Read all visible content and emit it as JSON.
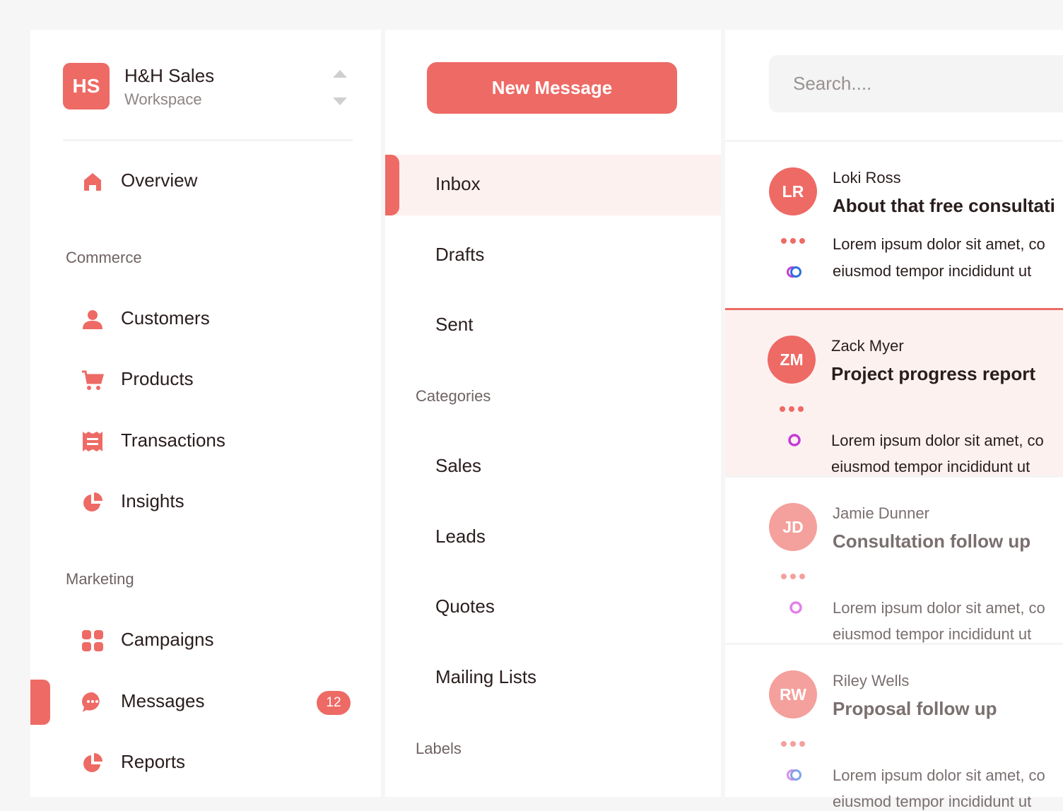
{
  "workspace": {
    "initials": "HS",
    "name": "H&H Sales",
    "subtitle": "Workspace"
  },
  "sidebar": {
    "overview": "Overview",
    "sections": {
      "commerce": "Commerce",
      "marketing": "Marketing"
    },
    "commerce_items": [
      {
        "label": "Customers",
        "icon": "person-icon"
      },
      {
        "label": "Products",
        "icon": "cart-icon"
      },
      {
        "label": "Transactions",
        "icon": "receipt-icon"
      },
      {
        "label": "Insights",
        "icon": "pie-chart-icon"
      }
    ],
    "marketing_items": [
      {
        "label": "Campaigns",
        "icon": "grid-icon"
      },
      {
        "label": "Messages",
        "icon": "chat-bubble-icon",
        "badge": "12",
        "active": true
      },
      {
        "label": "Reports",
        "icon": "pie-chart-icon"
      }
    ]
  },
  "folders": {
    "new_message": "New Message",
    "main": [
      {
        "label": "Inbox",
        "active": true
      },
      {
        "label": "Drafts"
      },
      {
        "label": "Sent"
      }
    ],
    "categories_label": "Categories",
    "categories": [
      "Sales",
      "Leads",
      "Quotes",
      "Mailing Lists"
    ],
    "labels_label": "Labels"
  },
  "search": {
    "placeholder": "Search...."
  },
  "messages": [
    {
      "initials": "LR",
      "sender": "Loki Ross",
      "subject": "About that free consultati",
      "line1": "Lorem ipsum dolor sit amet, co",
      "line2": "eiusmod tempor incididunt ut",
      "avatar_color": "#ee6a65"
    },
    {
      "initials": "ZM",
      "sender": "Zack Myer",
      "subject": "Project progress report",
      "line1": "Lorem ipsum dolor sit amet, co",
      "line2": "eiusmod tempor incididunt ut",
      "avatar_color": "#ee6a65",
      "selected": true
    },
    {
      "initials": "JD",
      "sender": "Jamie Dunner",
      "subject": "Consultation follow up",
      "line1": "Lorem ipsum dolor sit amet, co",
      "line2": "eiusmod tempor incididunt ut",
      "avatar_color": "#f4a09d"
    },
    {
      "initials": "RW",
      "sender": "Riley Wells",
      "subject": "Proposal follow up",
      "line1": "Lorem ipsum dolor sit amet, co",
      "line2": "eiusmod tempor incididunt ut",
      "avatar_color": "#f4a09d"
    }
  ],
  "colors": {
    "accent": "#ee6a65",
    "accent_light": "#fdf1f0",
    "ring_blue": "#2f6fe0",
    "ring_purple": "#c23cd6"
  }
}
